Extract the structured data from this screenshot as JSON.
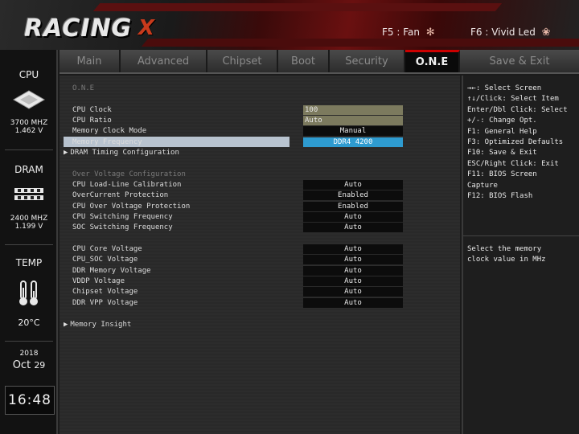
{
  "header": {
    "logo": "RACING",
    "hotkeys": [
      {
        "label": "F5 : Fan",
        "icon": "fan-icon"
      },
      {
        "label": "F6 : Vivid Led",
        "icon": "led-icon"
      }
    ]
  },
  "left_panel": {
    "cpu": {
      "title": "CPU",
      "freq": "3700 MHZ",
      "volt": "1.462 V"
    },
    "dram": {
      "title": "DRAM",
      "freq": "2400 MHZ",
      "volt": "1.199 V"
    },
    "temp": {
      "title": "TEMP",
      "value": "20°C"
    },
    "date": {
      "year": "2018",
      "month": "Oct",
      "day": "29"
    },
    "time": "16:48"
  },
  "tabs": [
    "Main",
    "Advanced",
    "Chipset",
    "Boot",
    "Security",
    "O.N.E",
    "Save & Exit"
  ],
  "active_tab": "O.N.E",
  "main": {
    "title": "O.N.E",
    "items": [
      {
        "label": "CPU Clock",
        "value": "100"
      },
      {
        "label": "CPU Ratio",
        "value": "Auto"
      },
      {
        "label": "Memory Clock Mode",
        "value": "Manual"
      },
      {
        "label": "Memory Frequency",
        "value": "DDR4 4200"
      },
      {
        "label": "DRAM Timing Configuration"
      },
      {
        "label": "Over Voltage Configuration"
      },
      {
        "label": "CPU Load-Line Calibration",
        "value": "Auto"
      },
      {
        "label": "OverCurrent Protection",
        "value": "Enabled"
      },
      {
        "label": "CPU Over Voltage Protection",
        "value": "Enabled"
      },
      {
        "label": "CPU Switching Frequency",
        "value": "Auto"
      },
      {
        "label": "SOC Switching Frequency",
        "value": "Auto"
      },
      {
        "label": "CPU Core Voltage",
        "value": "Auto"
      },
      {
        "label": "CPU_SOC Voltage",
        "value": "Auto"
      },
      {
        "label": "DDR Memory Voltage",
        "value": "Auto"
      },
      {
        "label": "VDDP Voltage",
        "value": "Auto"
      },
      {
        "label": "Chipset Voltage",
        "value": "Auto"
      },
      {
        "label": "DDR VPP Voltage",
        "value": "Auto"
      },
      {
        "label": "Memory Insight"
      }
    ]
  },
  "help": {
    "keys": [
      "→←: Select Screen",
      "↑↓/Click: Select Item",
      "Enter/Dbl Click: Select",
      "+/-: Change Opt.",
      "F1: General Help",
      "F3: Optimized Defaults",
      "F10: Save & Exit",
      "ESC/Right Click: Exit",
      "F11: BIOS Screen",
      "Capture",
      "F12: BIOS Flash"
    ],
    "description": [
      "Select the memory",
      "clock value in MHz"
    ]
  },
  "colors": {
    "accent": "#cc0000",
    "selected_value": "#2e9bd0",
    "selected_row": "#b8c3cf",
    "edit_value": "#7c7a5e"
  }
}
